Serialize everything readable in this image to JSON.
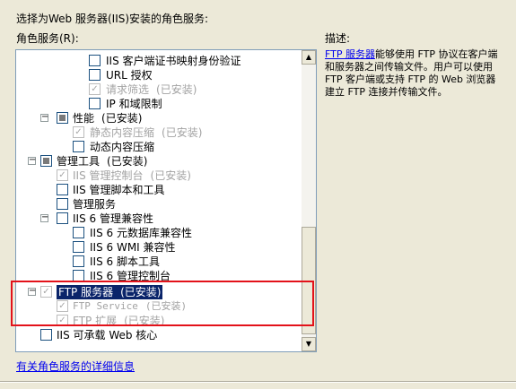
{
  "header": {
    "title": "选择为Web 服务器(IIS)安装的角色服务:",
    "roles_label": "角色服务(R):",
    "description_label": "描述:"
  },
  "tree": {
    "items": [
      {
        "label": "IIS 客户端证书映射身份验证",
        "status": "",
        "checked": false,
        "disabled": false,
        "selected": false
      },
      {
        "label": "URL 授权",
        "status": "",
        "checked": false,
        "disabled": false,
        "selected": false
      },
      {
        "label": "请求筛选",
        "status": "(已安装)",
        "checked": true,
        "disabled": true,
        "selected": false
      },
      {
        "label": "IP 和域限制",
        "status": "",
        "checked": false,
        "disabled": false,
        "selected": false
      },
      {
        "label": "性能",
        "status": "(已安装)",
        "checked": "partial",
        "disabled": false,
        "selected": false,
        "expander": "minus"
      },
      {
        "label": "静态内容压缩",
        "status": "(已安装)",
        "checked": true,
        "disabled": true,
        "selected": false
      },
      {
        "label": "动态内容压缩",
        "status": "",
        "checked": false,
        "disabled": false,
        "selected": false
      },
      {
        "label": "管理工具",
        "status": "(已安装)",
        "checked": "partial",
        "disabled": false,
        "selected": false,
        "expander": "minus"
      },
      {
        "label": "IIS 管理控制台",
        "status": "(已安装)",
        "checked": true,
        "disabled": true,
        "selected": false
      },
      {
        "label": "IIS 管理脚本和工具",
        "status": "",
        "checked": false,
        "disabled": false,
        "selected": false
      },
      {
        "label": "管理服务",
        "status": "",
        "checked": false,
        "disabled": false,
        "selected": false
      },
      {
        "label": "IIS 6 管理兼容性",
        "status": "",
        "checked": false,
        "disabled": false,
        "selected": false,
        "expander": "minus"
      },
      {
        "label": "IIS 6 元数据库兼容性",
        "status": "",
        "checked": false,
        "disabled": false,
        "selected": false
      },
      {
        "label": "IIS 6 WMI 兼容性",
        "status": "",
        "checked": false,
        "disabled": false,
        "selected": false
      },
      {
        "label": "IIS 6 脚本工具",
        "status": "",
        "checked": false,
        "disabled": false,
        "selected": false
      },
      {
        "label": "IIS 6 管理控制台",
        "status": "",
        "checked": false,
        "disabled": false,
        "selected": false
      },
      {
        "label": "FTP 服务器",
        "status": "(已安装)",
        "checked": true,
        "disabled": true,
        "selected": true,
        "expander": "minus"
      },
      {
        "label": "FTP Service",
        "status": "(已安装)",
        "checked": true,
        "disabled": true,
        "selected": false
      },
      {
        "label": "FTP 扩展",
        "status": "(已安装)",
        "checked": true,
        "disabled": true,
        "selected": false
      },
      {
        "label": "IIS 可承载 Web 核心",
        "status": "",
        "checked": false,
        "disabled": false,
        "selected": false
      }
    ]
  },
  "description": {
    "link_text": "FTP 服务器",
    "body": "能够使用 FTP 协议在客户端和服务器之间传输文件。用户可以使用 FTP 客户端或支持 FTP 的 Web 浏览器建立 FTP 连接并传输文件。"
  },
  "footer": {
    "more_info_link": "有关角色服务的详细信息"
  },
  "colors": {
    "highlight_border": "#e3121a",
    "selection_bg": "#0a246a",
    "link": "#0000ee"
  },
  "icons": {
    "scroll_up": "▲",
    "scroll_down": "▼",
    "checkmark": "✓",
    "collapse": "−"
  }
}
